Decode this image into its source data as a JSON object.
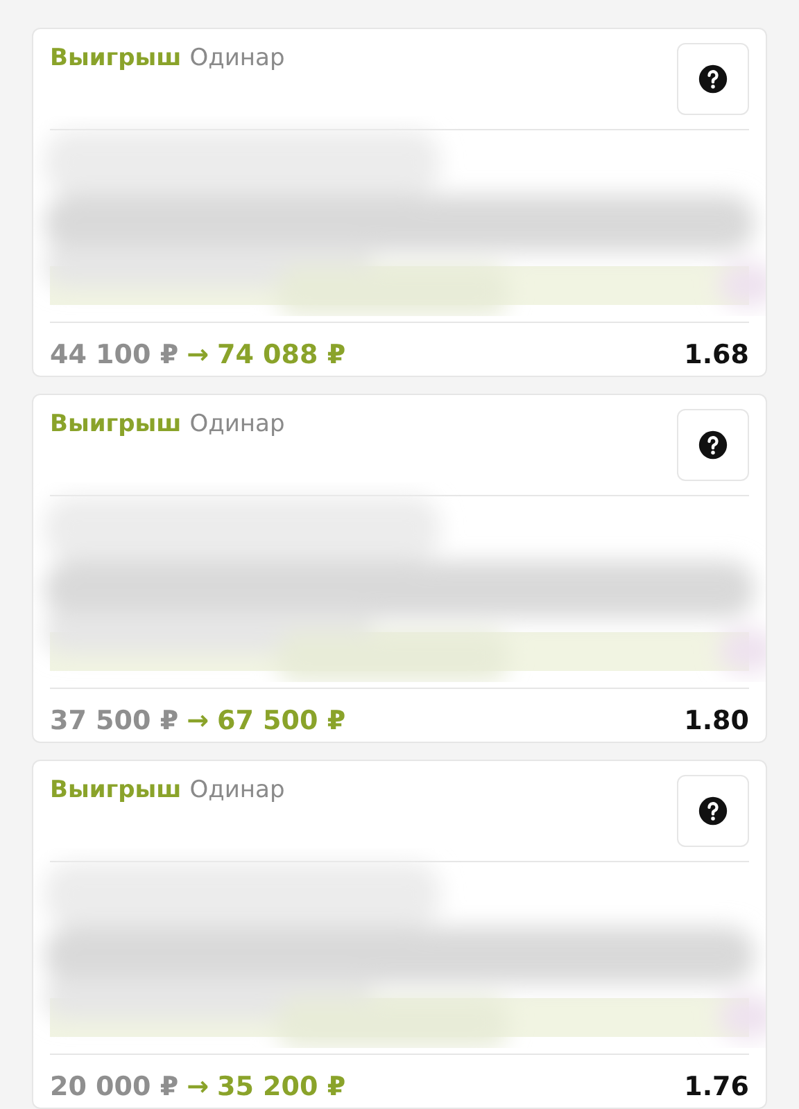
{
  "bets": [
    {
      "status": "Выигрыш",
      "bet_type": "Одинар",
      "stake": "44 100 ₽",
      "arrow": "→",
      "payout": "74 088 ₽",
      "odds": "1.68"
    },
    {
      "status": "Выигрыш",
      "bet_type": "Одинар",
      "stake": "37 500 ₽",
      "arrow": "→",
      "payout": "67 500 ₽",
      "odds": "1.80"
    },
    {
      "status": "Выигрыш",
      "bet_type": "Одинар",
      "stake": "20 000 ₽",
      "arrow": "→",
      "payout": "35 200 ₽",
      "odds": "1.76"
    }
  ]
}
